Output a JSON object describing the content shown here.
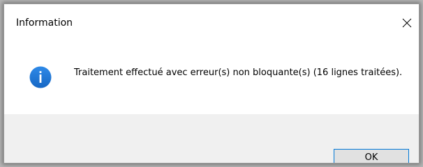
{
  "window": {
    "title": "Information",
    "close_icon": "close-icon"
  },
  "message": {
    "icon": "info-icon",
    "icon_color": "#1a74d6",
    "text": "Traitement effectué avec erreur(s) non bloquante(s) (16 lignes traitées)."
  },
  "buttons": {
    "ok_label": "OK"
  }
}
